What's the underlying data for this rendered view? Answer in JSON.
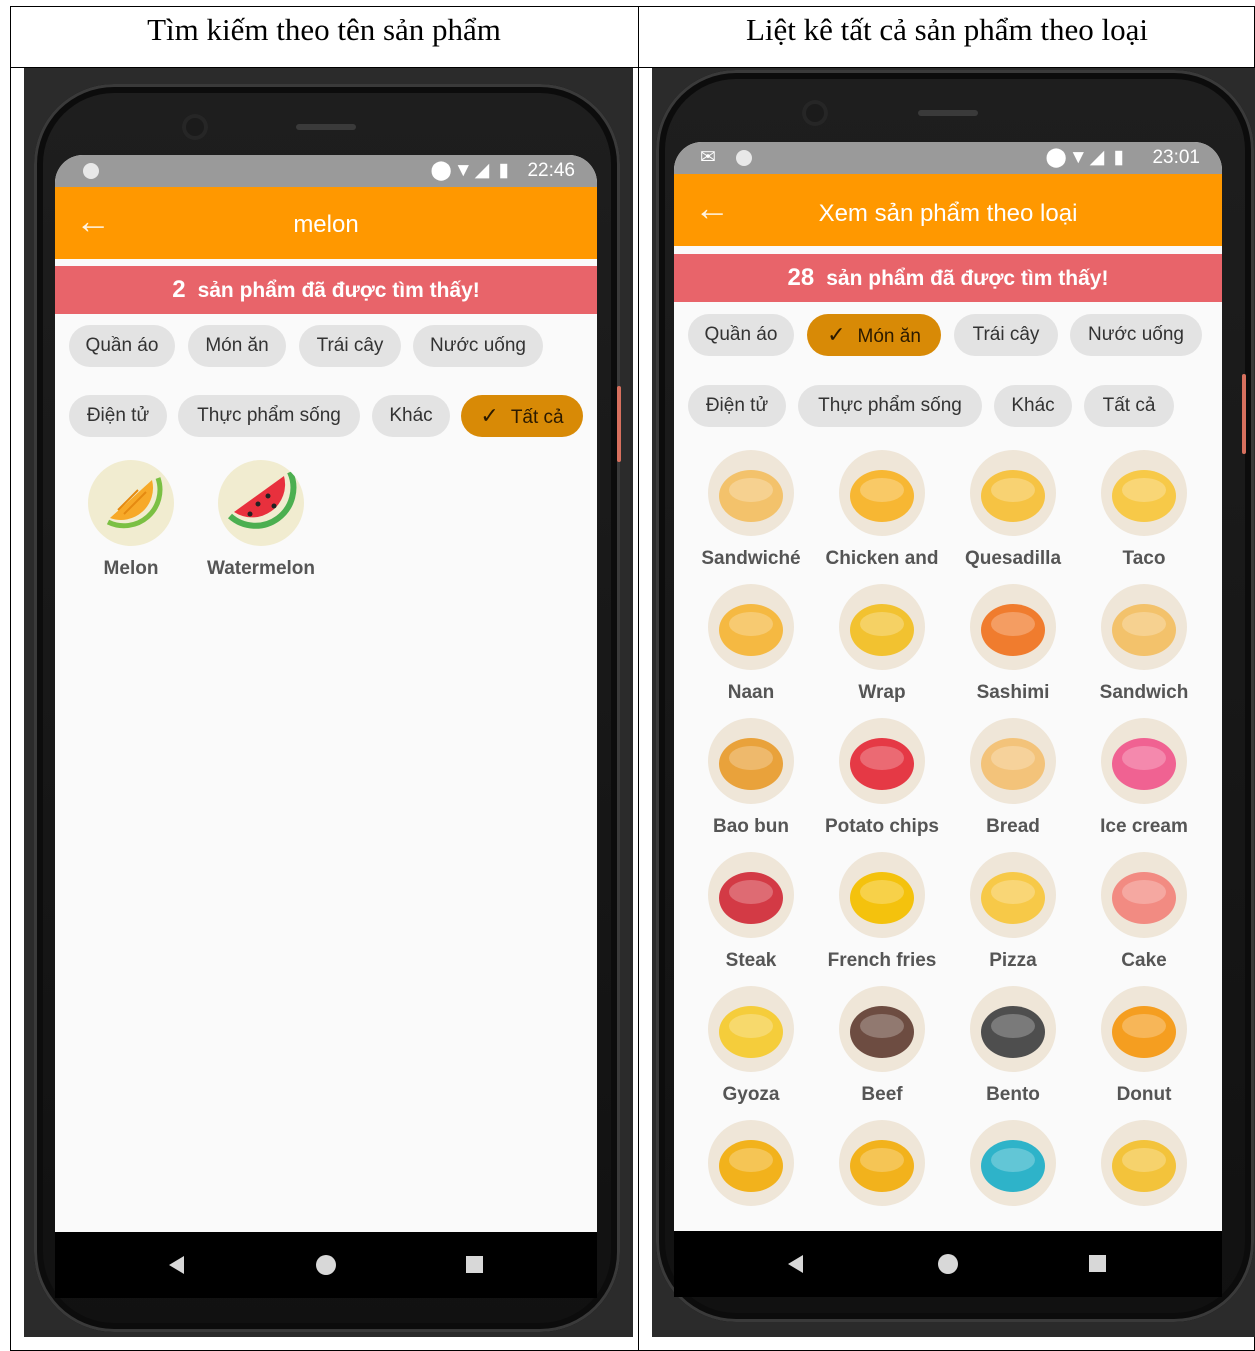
{
  "captions": {
    "left": "Tìm kiếm theo tên sản phẩm",
    "right": "Liệt kê tất cả sản phẩm theo loại"
  },
  "left_phone": {
    "status": {
      "time": "22:46",
      "icons": [
        "location-icon",
        "wifi-icon",
        "signal-icon",
        "battery-icon"
      ]
    },
    "appbar": {
      "title": "melon"
    },
    "banner": {
      "count": "2",
      "text": "sản phẩm đã được tìm thấy!"
    },
    "chips": [
      {
        "label": "Quần áo",
        "selected": false
      },
      {
        "label": "Món ăn",
        "selected": false
      },
      {
        "label": "Trái cây",
        "selected": false
      },
      {
        "label": "Nước uống",
        "selected": false
      },
      {
        "label": "Điện tử",
        "selected": false
      },
      {
        "label": "Thực phẩm sống",
        "selected": false
      },
      {
        "label": "Khác",
        "selected": false
      },
      {
        "label": "Tất cả",
        "selected": true
      }
    ],
    "products": [
      {
        "label": "Melon",
        "icon": "melon-icon"
      },
      {
        "label": "Watermelon",
        "icon": "watermelon-icon"
      }
    ]
  },
  "right_phone": {
    "status": {
      "time": "23:01",
      "icons": [
        "mail-icon",
        "location-icon",
        "wifi-icon",
        "signal-icon",
        "battery-icon"
      ]
    },
    "appbar": {
      "title": "Xem sản phẩm theo loại"
    },
    "banner": {
      "count": "28",
      "text": "sản phẩm đã được tìm thấy!"
    },
    "chips": [
      {
        "label": "Quần áo",
        "selected": false
      },
      {
        "label": "Món ăn",
        "selected": true
      },
      {
        "label": "Trái cây",
        "selected": false
      },
      {
        "label": "Nước uống",
        "selected": false
      },
      {
        "label": "Điện tử",
        "selected": false
      },
      {
        "label": "Thực phẩm sống",
        "selected": false
      },
      {
        "label": "Khác",
        "selected": false
      },
      {
        "label": "Tất cả",
        "selected": false
      }
    ],
    "products": [
      {
        "label": "Sandwiché",
        "icon": "sandwich-icon"
      },
      {
        "label": "Chicken and",
        "icon": "chicken-waffle-icon"
      },
      {
        "label": "Quesadilla",
        "icon": "quesadilla-icon"
      },
      {
        "label": "Taco",
        "icon": "taco-icon"
      },
      {
        "label": "Naan",
        "icon": "naan-icon"
      },
      {
        "label": "Wrap",
        "icon": "wrap-icon"
      },
      {
        "label": "Sashimi",
        "icon": "sashimi-icon"
      },
      {
        "label": "Sandwich",
        "icon": "sandwich-icon"
      },
      {
        "label": "Bao bun",
        "icon": "bao-bun-icon"
      },
      {
        "label": "Potato chips",
        "icon": "potato-chips-icon"
      },
      {
        "label": "Bread",
        "icon": "bread-bowl-icon"
      },
      {
        "label": "Ice cream",
        "icon": "ice-cream-icon"
      },
      {
        "label": "Steak",
        "icon": "steak-icon"
      },
      {
        "label": "French fries",
        "icon": "french-fries-icon"
      },
      {
        "label": "Pizza",
        "icon": "pizza-icon"
      },
      {
        "label": "Cake",
        "icon": "cake-icon"
      },
      {
        "label": "Gyoza",
        "icon": "gyoza-icon"
      },
      {
        "label": "Beef",
        "icon": "beef-icon"
      },
      {
        "label": "Bento",
        "icon": "bento-icon"
      },
      {
        "label": "Donut",
        "icon": "donut-icon"
      },
      {
        "label": "",
        "icon": "baguette-icon"
      },
      {
        "label": "",
        "icon": "baguette-icon"
      },
      {
        "label": "",
        "icon": "noodles-icon"
      },
      {
        "label": "",
        "icon": "paella-icon"
      }
    ]
  },
  "colors": {
    "appbar": "#ff9800",
    "banner": "#e8646a",
    "chip_selected": "#d88a06",
    "chip": "#e3e3e3"
  }
}
